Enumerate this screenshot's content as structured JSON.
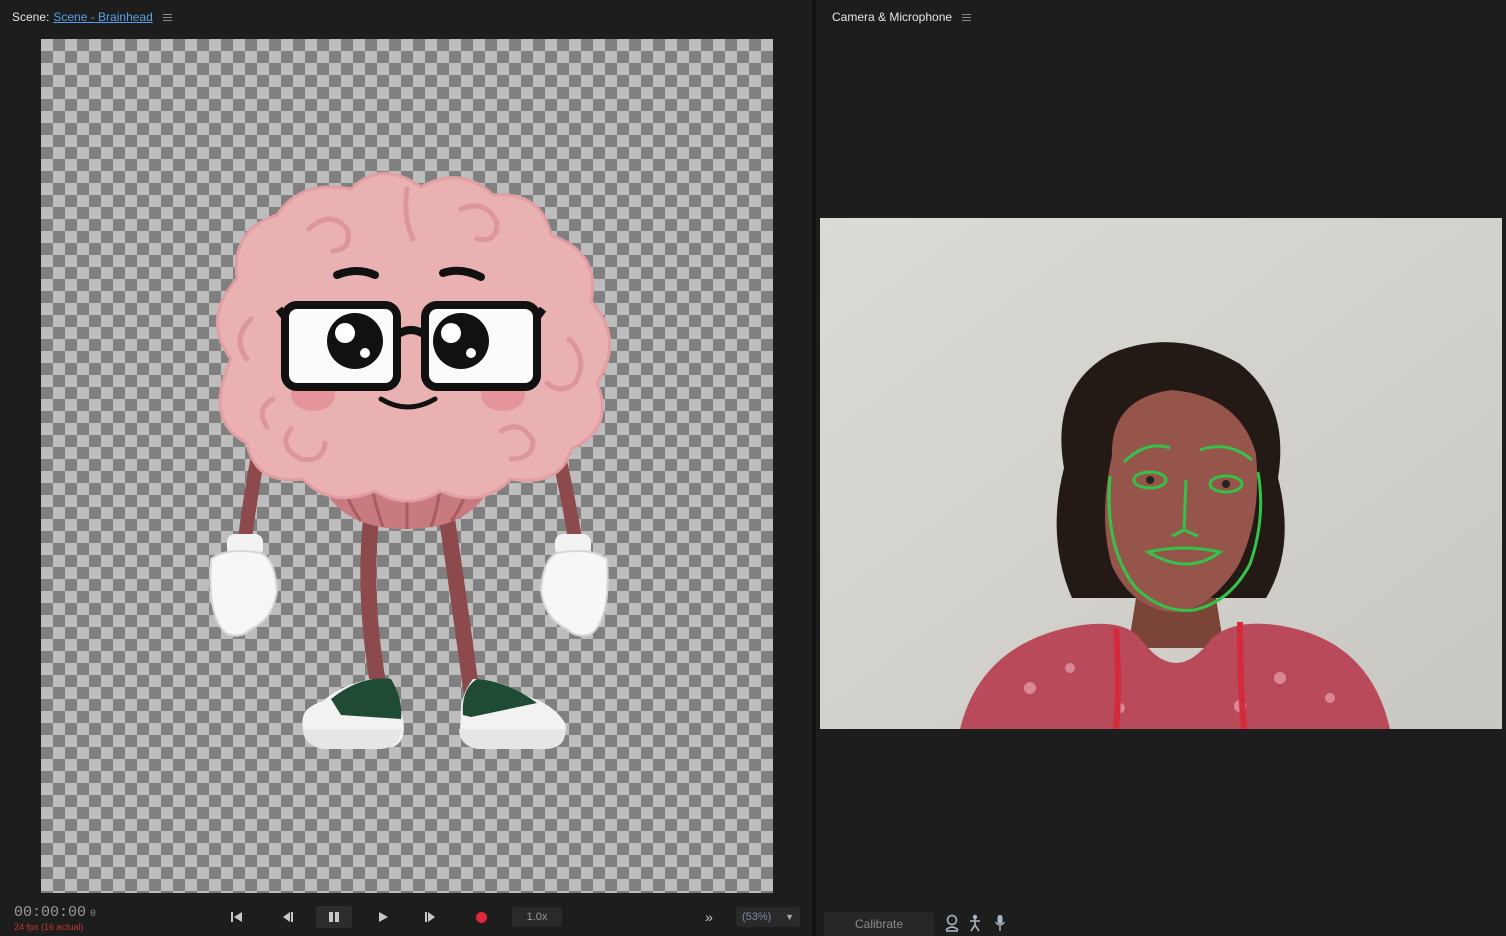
{
  "scene_panel": {
    "title": "Scene:",
    "scene_name": "Scene - Brainhead",
    "menu_icon": "hamburger-menu-icon"
  },
  "camera_panel": {
    "title": "Camera & Microphone",
    "menu_icon": "hamburger-menu-icon",
    "calibrate_label": "Calibrate",
    "icons": [
      "face-tracking-icon",
      "body-tracking-icon",
      "microphone-icon"
    ],
    "tracking_color": "#36c24a"
  },
  "transport": {
    "timecode": "00:00:00",
    "timecode_frame": "0",
    "fps": "24 fps (16 actual)",
    "speed": "1.0x",
    "zoom": "(53%)",
    "buttons": [
      "go-to-start-icon",
      "step-back-icon",
      "pause-icon",
      "play-icon",
      "step-forward-icon",
      "record-icon",
      "more-icon",
      "zoom-chevron-icon"
    ]
  },
  "colors": {
    "panel_bg": "#1d1d1d",
    "record": "#e0283a",
    "fps_warning": "#c0392b",
    "link": "#5aa0e6"
  }
}
